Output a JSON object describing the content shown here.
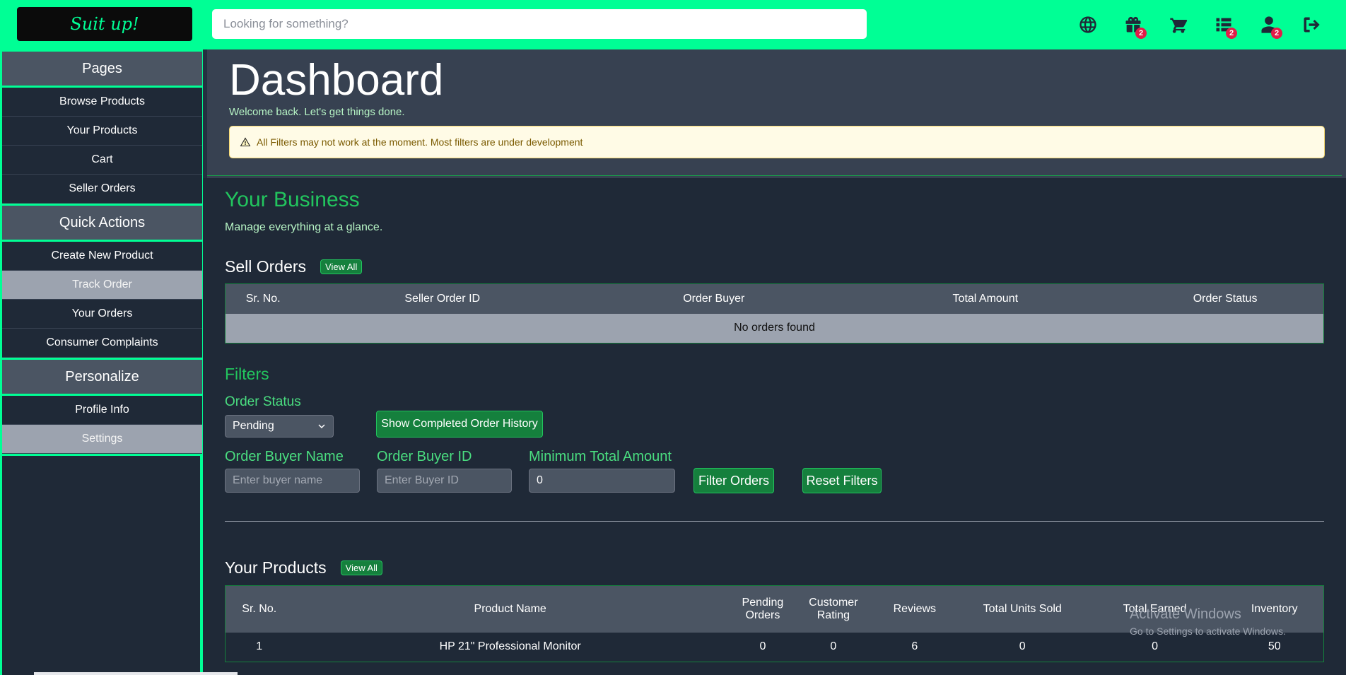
{
  "header": {
    "logo_text": "Suit up!",
    "search_placeholder": "Looking for something?",
    "icons": [
      {
        "name": "globe-icon",
        "badge": ""
      },
      {
        "name": "gift-icon",
        "badge": "2"
      },
      {
        "name": "cart-icon",
        "badge": ""
      },
      {
        "name": "list-icon",
        "badge": "2"
      },
      {
        "name": "user-icon",
        "badge": "2"
      },
      {
        "name": "logout-icon",
        "badge": ""
      }
    ]
  },
  "sidebar": {
    "pages_header": "Pages",
    "pages": [
      "Browse Products",
      "Your Products",
      "Cart",
      "Seller Orders"
    ],
    "quick_header": "Quick Actions",
    "quick": [
      "Create New Product",
      "Track Order",
      "Your Orders",
      "Consumer Complaints"
    ],
    "personalize_header": "Personalize",
    "personalize": [
      "Profile Info",
      "Settings"
    ]
  },
  "hero": {
    "title": "Dashboard",
    "subtitle": "Welcome back. Let's get things done.",
    "alert": "All Filters may not work at the moment. Most filters are under development"
  },
  "business": {
    "title": "Your Business",
    "subtitle": "Manage everything at a glance."
  },
  "sell_orders": {
    "title": "Sell Orders",
    "view_all": "View All",
    "columns": [
      "Sr. No.",
      "Seller Order ID",
      "Order Buyer",
      "Total Amount",
      "Order Status"
    ],
    "empty": "No orders found"
  },
  "filters": {
    "title": "Filters",
    "order_status_label": "Order Status",
    "order_status_value": "Pending",
    "completed_button": "Show Completed Order History",
    "buyer_name_label": "Order Buyer Name",
    "buyer_name_placeholder": "Enter buyer name",
    "buyer_id_label": "Order Buyer ID",
    "buyer_id_placeholder": "Enter Buyer ID",
    "min_amount_label": "Minimum Total Amount",
    "min_amount_value": "0",
    "filter_button": "Filter Orders",
    "reset_button": "Reset Filters"
  },
  "products": {
    "title": "Your Products",
    "view_all": "View All",
    "columns": [
      "Sr. No.",
      "Product Name",
      "Pending Orders",
      "Customer Rating",
      "Reviews",
      "Total Units Sold",
      "Total Earned",
      "Inventory"
    ],
    "rows": [
      [
        "1",
        "HP 21\" Professional Monitor",
        "0",
        "0",
        "6",
        "0",
        "0",
        "50"
      ]
    ]
  },
  "watermark": {
    "line1": "Activate Windows",
    "line2": "Go to Settings to activate Windows."
  }
}
